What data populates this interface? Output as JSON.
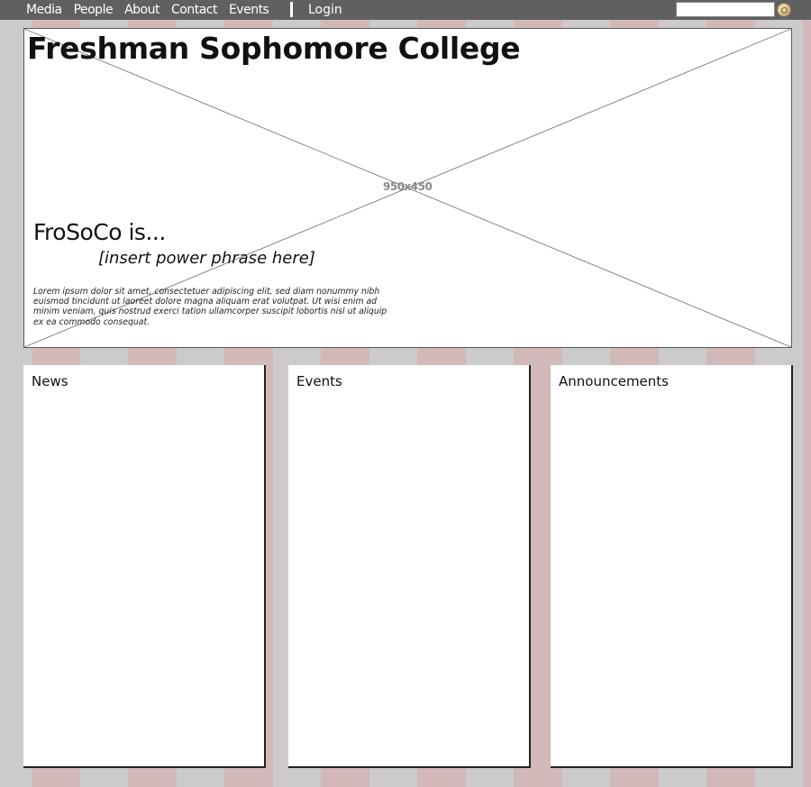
{
  "nav": {
    "items": [
      {
        "label": "Media"
      },
      {
        "label": "People"
      },
      {
        "label": "About"
      },
      {
        "label": "Contact"
      },
      {
        "label": "Events"
      }
    ],
    "login_label": "Login",
    "search": {
      "value": "",
      "placeholder": ""
    },
    "search_icon": "search-button-icon"
  },
  "hero": {
    "site_title": "Freshman Sophomore College",
    "image_placeholder_text": "950x450",
    "tagline_lead": "FroSoCo is...",
    "tagline_phrase": "[insert power phrase here]",
    "body_text": "Lorem ipsum dolor sit amet, consectetuer adipiscing elit, sed diam nonummy nibh euismod tincidunt ut laoreet dolore magna aliquam erat volutpat. Ut wisi enim ad minim veniam, quis nostrud exerci tation ullamcorper suscipit lobortis nisl ut aliquip ex ea commodo consequat."
  },
  "panels": {
    "news": {
      "title": "News"
    },
    "events": {
      "title": "Events"
    },
    "announcements": {
      "title": "Announcements"
    }
  },
  "colors": {
    "topbar": "#606060",
    "page_background": "#cbcbcb",
    "grid_column": "#d2b8b9"
  }
}
